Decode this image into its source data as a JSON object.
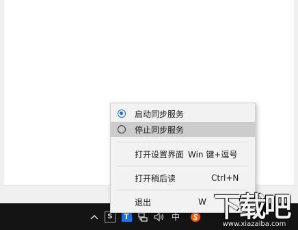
{
  "menu": {
    "items": [
      {
        "label": "启动同步服务",
        "selected": true
      },
      {
        "label": "停止同步服务",
        "selected": false
      },
      {
        "label": "打开设置界面",
        "shortcut": "Win 键+逗号"
      },
      {
        "label": "打开稍后读",
        "shortcut": "Ctrl+N"
      },
      {
        "label": "退出",
        "shortcut": "W"
      }
    ]
  },
  "taskbar": {
    "ime_label": "中",
    "tray_t_label": "T",
    "tray_s_label": "S"
  },
  "watermark": {
    "logo_text": "下载吧",
    "url_text": "www.xiazaiba.com"
  },
  "colors": {
    "accent": "#1670d9",
    "hover": "#cccccc",
    "taskbar": "#141414",
    "sogou": "#ff5a00"
  }
}
